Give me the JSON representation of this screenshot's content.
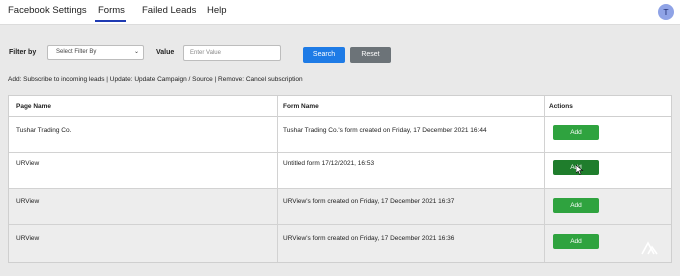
{
  "nav": {
    "items": [
      {
        "label": "Facebook Settings"
      },
      {
        "label": "Forms"
      },
      {
        "label": "Failed Leads"
      },
      {
        "label": "Help"
      }
    ],
    "active": "Forms",
    "avatar_initial": "T"
  },
  "filter": {
    "filter_by_label": "Filter by",
    "select_value": "Select Filter By",
    "value_label": "Value",
    "value_placeholder": "Enter Value",
    "search_label": "Search",
    "reset_label": "Reset"
  },
  "legend": "Add: Subscribe to incoming leads | Update: Update Campaign / Source | Remove: Cancel subscription",
  "table": {
    "headers": [
      "Page Name",
      "Form Name",
      "Actions"
    ],
    "rows": [
      {
        "page_name": "Tushar Trading Co.",
        "form_name": "Tushar Trading Co.'s form created on Friday, 17 December 2021 16:44",
        "action": "Add"
      },
      {
        "page_name": "URView",
        "form_name": "Untitled form 17/12/2021, 16:53",
        "action": "Add"
      },
      {
        "page_name": "URView",
        "form_name": "URView's form created on Friday, 17 December 2021 16:37",
        "action": "Add"
      },
      {
        "page_name": "URView",
        "form_name": "URView's form created on Friday, 17 December 2021 16:36",
        "action": "Add"
      }
    ]
  },
  "colors": {
    "primary": "#1e7be6",
    "secondary": "#6c7378",
    "success": "#2fa33f",
    "nav_active_underline": "#1f3bb3"
  }
}
